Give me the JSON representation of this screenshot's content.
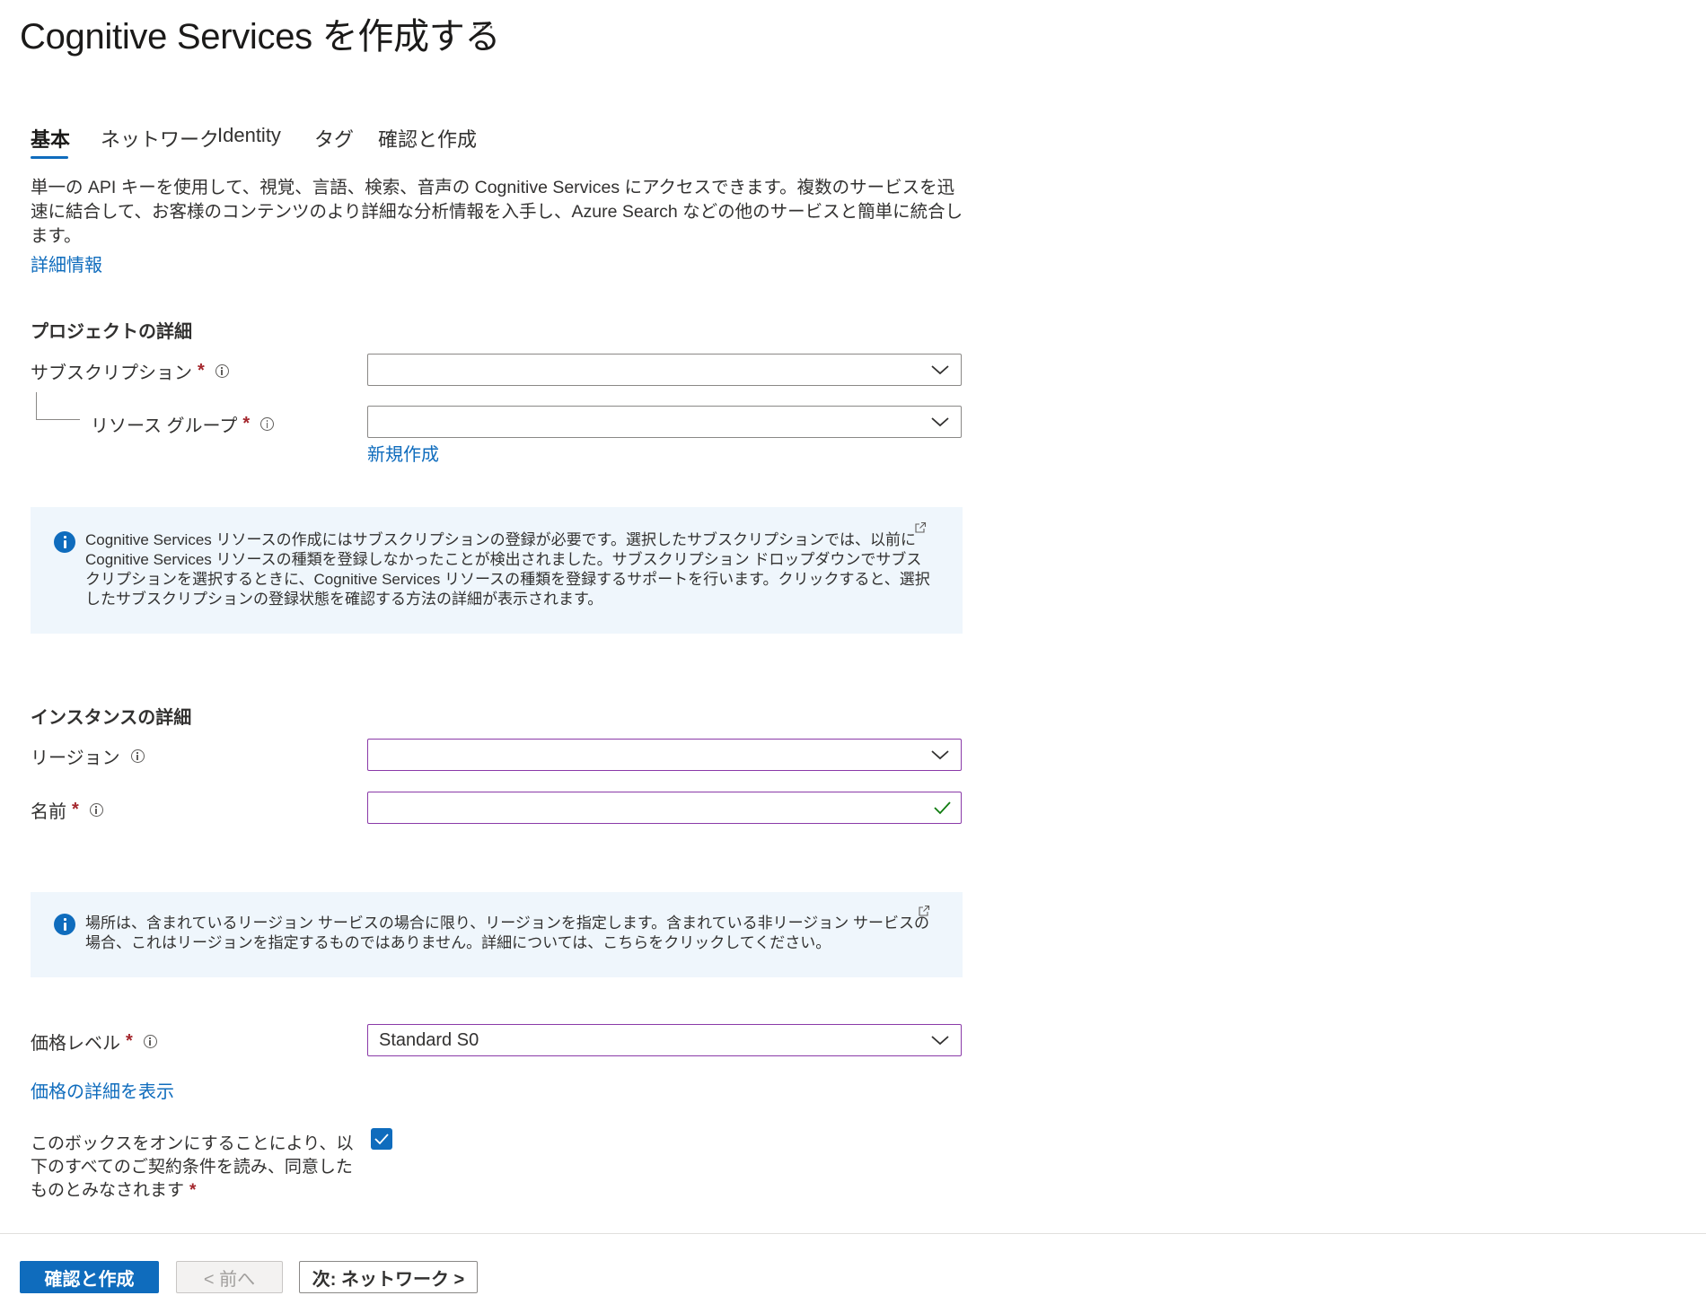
{
  "header": {
    "title": "Cognitive Services を作成する",
    "more_label": "···"
  },
  "tabs": [
    {
      "label": "基本",
      "active": true
    },
    {
      "label": "ネットワーク",
      "active": false
    },
    {
      "label": "Identity",
      "active": false
    },
    {
      "label": "タグ",
      "active": false
    },
    {
      "label": "確認と作成",
      "active": false
    }
  ],
  "intro": {
    "description": "単一の API キーを使用して、視覚、言語、検索、音声の Cognitive Services にアクセスできます。複数のサービスを迅速に結合して、お客様のコンテンツのより詳細な分析情報を入手し、Azure Search などの他のサービスと簡単に統合します。",
    "learn_more": "詳細情報"
  },
  "project": {
    "heading": "プロジェクトの詳細",
    "subscription_label": "サブスクリプション",
    "subscription_value": "",
    "resource_group_label": "リソース グループ",
    "resource_group_value": "",
    "create_new": "新規作成"
  },
  "info1": {
    "text": "Cognitive Services リソースの作成にはサブスクリプションの登録が必要です。選択したサブスクリプションでは、以前に Cognitive Services リソースの種類を登録しなかったことが検出されました。サブスクリプション ドロップダウンでサブスクリプションを選択するときに、Cognitive Services リソースの種類を登録するサポートを行います。クリックすると、選択したサブスクリプションの登録状態を確認する方法の詳細が表示されます。"
  },
  "instance": {
    "heading": "インスタンスの詳細",
    "region_label": "リージョン",
    "region_value": "",
    "name_label": "名前",
    "name_value": ""
  },
  "info2": {
    "text": "場所は、含まれているリージョン サービスの場合に限り、リージョンを指定します。含まれている非リージョン サービスの場合、これはリージョンを指定するものではありません。詳細については、こちらをクリックしてください。"
  },
  "pricing": {
    "label": "価格レベル",
    "value": "Standard S0",
    "details_link": "価格の詳細を表示"
  },
  "terms": {
    "text": "このボックスをオンにすることにより、以下のすべてのご契約条件を読み、同意したものとみなされます",
    "required_mark": "*",
    "checked": true
  },
  "required_mark": "*",
  "footer": {
    "review_create": "確認と作成",
    "previous": "< 前へ",
    "next": "次: ネットワーク >"
  },
  "colors": {
    "accent": "#0f6cbd",
    "required": "#a4262c",
    "focus_border": "#8a3aa8",
    "info_background": "#eff6fc",
    "valid_check": "#107c10"
  },
  "icons": [
    "more-icon",
    "info-icon",
    "chevron-down-icon",
    "checkmark-icon",
    "external-link-icon",
    "info-filled-icon"
  ]
}
